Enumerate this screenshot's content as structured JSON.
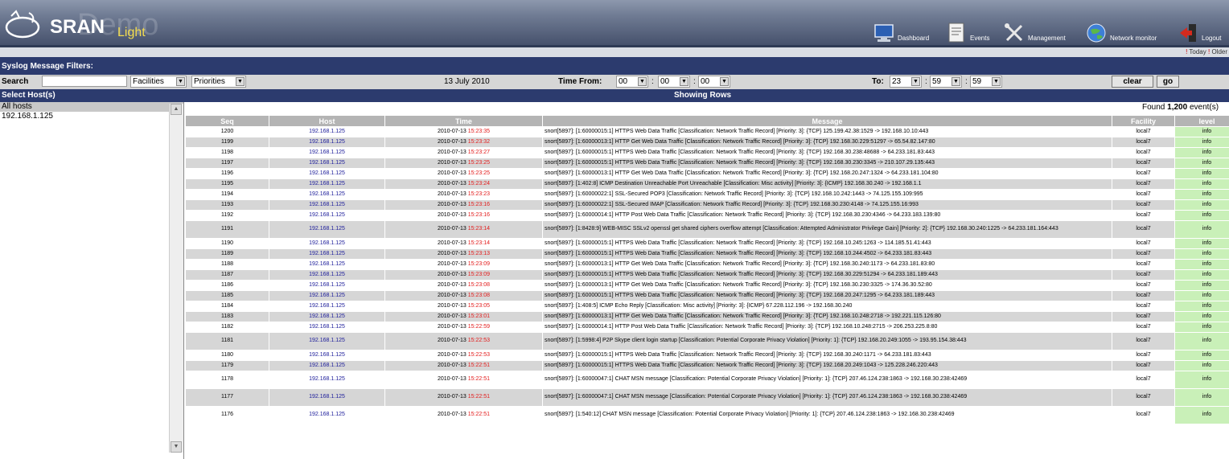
{
  "app": {
    "brand": "SRAN",
    "edition": "Light",
    "watermark": "Demo"
  },
  "nav": [
    {
      "label": "Dashboard",
      "icon": "monitor-icon"
    },
    {
      "label": "Events",
      "icon": "document-icon"
    },
    {
      "label": "Management",
      "icon": "tools-icon"
    },
    {
      "label": "Network monitor",
      "icon": "globe-icon"
    },
    {
      "label": "Logout",
      "icon": "logout-icon"
    }
  ],
  "quicklinks": {
    "today": "Today",
    "older": "Older"
  },
  "filters": {
    "title": "Syslog Message Filters:",
    "search_label": "Search",
    "search_value": "",
    "facilities": "Facilities",
    "priorities": "Priorities",
    "date": "13 July 2010",
    "time_from_label": "Time From:",
    "from_h": "00",
    "from_m": "00",
    "from_s": "00",
    "to_label": "To:",
    "to_h": "23",
    "to_m": "59",
    "to_s": "59",
    "clear": "clear",
    "go": "go"
  },
  "hosts": {
    "title": "Select Host(s)",
    "items": [
      "All hosts",
      "192.168.1.125"
    ]
  },
  "results": {
    "title": "Showing Rows",
    "found_prefix": "Found ",
    "found_count": "1,200",
    "found_suffix": " event(s)"
  },
  "columns": [
    "Seq",
    "Host",
    "Time",
    "Message",
    "Facility",
    "level"
  ],
  "rows": [
    {
      "seq": "1200",
      "host": "192.168.1.125",
      "date": "2010-07-13",
      "time": "15:23:35",
      "msg": "snort[5897]: [1:60000015:1] HTTPS Web Data Traffic [Classification: Network Traffic Record] [Priority: 3]: {TCP} 125.199.42.38:1529 -> 192.168.10.10:443",
      "facility": "local7",
      "level": "info"
    },
    {
      "seq": "1199",
      "host": "192.168.1.125",
      "date": "2010-07-13",
      "time": "15:23:32",
      "msg": "snort[5897]: [1:60000013:1] HTTP Get Web Data Traffic [Classification: Network Traffic Record] [Priority: 3]: {TCP} 192.168.30.229:51297 -> 65.54.82.147:80",
      "facility": "local7",
      "level": "info"
    },
    {
      "seq": "1198",
      "host": "192.168.1.125",
      "date": "2010-07-13",
      "time": "15:23:27",
      "msg": "snort[5897]: [1:60000015:1] HTTPS Web Data Traffic [Classification: Network Traffic Record] [Priority: 3]: {TCP} 192.168.30.238:48688 -> 64.233.181.83:443",
      "facility": "local7",
      "level": "info"
    },
    {
      "seq": "1197",
      "host": "192.168.1.125",
      "date": "2010-07-13",
      "time": "15:23:25",
      "msg": "snort[5897]: [1:60000015:1] HTTPS Web Data Traffic [Classification: Network Traffic Record] [Priority: 3]: {TCP} 192.168.30.230:3345 -> 210.107.29.135:443",
      "facility": "local7",
      "level": "info"
    },
    {
      "seq": "1196",
      "host": "192.168.1.125",
      "date": "2010-07-13",
      "time": "15:23:25",
      "msg": "snort[5897]: [1:60000013:1] HTTP Get Web Data Traffic [Classification: Network Traffic Record] [Priority: 3]: {TCP} 192.168.20.247:1324 -> 64.233.181.104:80",
      "facility": "local7",
      "level": "info"
    },
    {
      "seq": "1195",
      "host": "192.168.1.125",
      "date": "2010-07-13",
      "time": "15:23:24",
      "msg": "snort[5897]: [1:402:8] ICMP Destination Unreachable Port Unreachable [Classification: Misc activity] [Priority: 3]: {ICMP} 192.168.30.240 -> 192.168.1.1",
      "facility": "local7",
      "level": "info"
    },
    {
      "seq": "1194",
      "host": "192.168.1.125",
      "date": "2010-07-13",
      "time": "15:23:23",
      "msg": "snort[5897]: [1:60000022:1] SSL-Secured POP3 [Classification: Network Traffic Record] [Priority: 3]: {TCP} 192.168.10.242:1443 -> 74.125.155.109:995",
      "facility": "local7",
      "level": "info"
    },
    {
      "seq": "1193",
      "host": "192.168.1.125",
      "date": "2010-07-13",
      "time": "15:23:16",
      "msg": "snort[5897]: [1:60000022:1] SSL-Secured IMAP [Classification: Network Traffic Record] [Priority: 3]: {TCP} 192.168.30.230:4148 -> 74.125.155.16:993",
      "facility": "local7",
      "level": "info"
    },
    {
      "seq": "1192",
      "host": "192.168.1.125",
      "date": "2010-07-13",
      "time": "15:23:16",
      "msg": "snort[5897]: [1:60000014:1] HTTP Post Web Data Traffic [Classification: Network Traffic Record] [Priority: 3]: {TCP} 192.168.30.230:4346 -> 64.233.183.139:80",
      "facility": "local7",
      "level": "info"
    },
    {
      "seq": "1191",
      "host": "192.168.1.125",
      "date": "2010-07-13",
      "time": "15:23:14",
      "msg": "snort[5897]: [1:8428:9] WEB-MISC SSLv2 openssl get shared ciphers overflow attempt [Classification: Attempted Administrator Privilege Gain] [Priority: 2]: {TCP} 192.168.30.240:1225 -> 64.233.181.164:443",
      "facility": "local7",
      "level": "info",
      "tall": true
    },
    {
      "seq": "1190",
      "host": "192.168.1.125",
      "date": "2010-07-13",
      "time": "15:23:14",
      "msg": "snort[5897]: [1:60000015:1] HTTPS Web Data Traffic [Classification: Network Traffic Record] [Priority: 3]: {TCP} 192.168.10.245:1263 -> 114.185.51.41:443",
      "facility": "local7",
      "level": "info"
    },
    {
      "seq": "1189",
      "host": "192.168.1.125",
      "date": "2010-07-13",
      "time": "15:23:13",
      "msg": "snort[5897]: [1:60000015:1] HTTPS Web Data Traffic [Classification: Network Traffic Record] [Priority: 3]: {TCP} 192.168.10.244:4502 -> 64.233.181.83:443",
      "facility": "local7",
      "level": "info"
    },
    {
      "seq": "1188",
      "host": "192.168.1.125",
      "date": "2010-07-13",
      "time": "15:23:09",
      "msg": "snort[5897]: [1:60000013:1] HTTP Get Web Data Traffic [Classification: Network Traffic Record] [Priority: 3]: {TCP} 192.168.30.240:1173 -> 64.233.181.83:80",
      "facility": "local7",
      "level": "info"
    },
    {
      "seq": "1187",
      "host": "192.168.1.125",
      "date": "2010-07-13",
      "time": "15:23:09",
      "msg": "snort[5897]: [1:60000015:1] HTTPS Web Data Traffic [Classification: Network Traffic Record] [Priority: 3]: {TCP} 192.168.30.229:51294 -> 64.233.181.189:443",
      "facility": "local7",
      "level": "info"
    },
    {
      "seq": "1186",
      "host": "192.168.1.125",
      "date": "2010-07-13",
      "time": "15:23:08",
      "msg": "snort[5897]: [1:60000013:1] HTTP Get Web Data Traffic [Classification: Network Traffic Record] [Priority: 3]: {TCP} 192.168.30.230:3325 -> 174.36.30.52:80",
      "facility": "local7",
      "level": "info"
    },
    {
      "seq": "1185",
      "host": "192.168.1.125",
      "date": "2010-07-13",
      "time": "15:23:08",
      "msg": "snort[5897]: [1:60000015:1] HTTPS Web Data Traffic [Classification: Network Traffic Record] [Priority: 3]: {TCP} 192.168.20.247:1295 -> 64.233.181.189:443",
      "facility": "local7",
      "level": "info"
    },
    {
      "seq": "1184",
      "host": "192.168.1.125",
      "date": "2010-07-13",
      "time": "15:23:05",
      "msg": "snort[5897]: [1:408:5] ICMP Echo Reply [Classification: Misc activity] [Priority: 3]: {ICMP} 67.228.112.196 -> 192.168.30.240",
      "facility": "local7",
      "level": "info"
    },
    {
      "seq": "1183",
      "host": "192.168.1.125",
      "date": "2010-07-13",
      "time": "15:23:01",
      "msg": "snort[5897]: [1:60000013:1] HTTP Get Web Data Traffic [Classification: Network Traffic Record] [Priority: 3]: {TCP} 192.168.10.248:2718 -> 192.221.115.126:80",
      "facility": "local7",
      "level": "info"
    },
    {
      "seq": "1182",
      "host": "192.168.1.125",
      "date": "2010-07-13",
      "time": "15:22:59",
      "msg": "snort[5897]: [1:60000014:1] HTTP Post Web Data Traffic [Classification: Network Traffic Record] [Priority: 3]: {TCP} 192.168.10.248:2715 -> 206.253.225.8:80",
      "facility": "local7",
      "level": "info"
    },
    {
      "seq": "1181",
      "host": "192.168.1.125",
      "date": "2010-07-13",
      "time": "15:22:53",
      "msg": "snort[5897]: [1:5998:4] P2P Skype client login startup [Classification: Potential Corporate Privacy Violation] [Priority: 1]: {TCP} 192.168.20.249:1055 -> 193.95.154.38:443",
      "facility": "local7",
      "level": "info",
      "tall": true
    },
    {
      "seq": "1180",
      "host": "192.168.1.125",
      "date": "2010-07-13",
      "time": "15:22:53",
      "msg": "snort[5897]: [1:60000015:1] HTTPS Web Data Traffic [Classification: Network Traffic Record] [Priority: 3]: {TCP} 192.168.30.240:1171 -> 64.233.181.83:443",
      "facility": "local7",
      "level": "info"
    },
    {
      "seq": "1179",
      "host": "192.168.1.125",
      "date": "2010-07-13",
      "time": "15:22:51",
      "msg": "snort[5897]: [1:60000015:1] HTTPS Web Data Traffic [Classification: Network Traffic Record] [Priority: 3]: {TCP} 192.168.20.249:1043 -> 125.228.246.220:443",
      "facility": "local7",
      "level": "info"
    },
    {
      "seq": "1178",
      "host": "192.168.1.125",
      "date": "2010-07-13",
      "time": "15:22:51",
      "msg": "snort[5897]: [1:60000047:1] CHAT MSN message [Classification: Potential Corporate Privacy Violation] [Priority: 1]: {TCP} 207.46.124.238:1863 -> 192.168.30.238:42469",
      "facility": "local7",
      "level": "info",
      "tall": true
    },
    {
      "seq": "1177",
      "host": "192.168.1.125",
      "date": "2010-07-13",
      "time": "15:22:51",
      "msg": "snort[5897]: [1:60000047:1] CHAT MSN message [Classification: Potential Corporate Privacy Violation] [Priority: 1]: {TCP} 207.46.124.238:1863 -> 192.168.30.238:42469",
      "facility": "local7",
      "level": "info",
      "tall": true
    },
    {
      "seq": "1176",
      "host": "192.168.1.125",
      "date": "2010-07-13",
      "time": "15:22:51",
      "msg": "snort[5897]: [1:540:12] CHAT MSN message [Classification: Potential Corporate Privacy Violation] [Priority: 1]: {TCP} 207.46.124.238:1863 -> 192.168.30.238:42469",
      "facility": "local7",
      "level": "info",
      "tall": true
    }
  ]
}
